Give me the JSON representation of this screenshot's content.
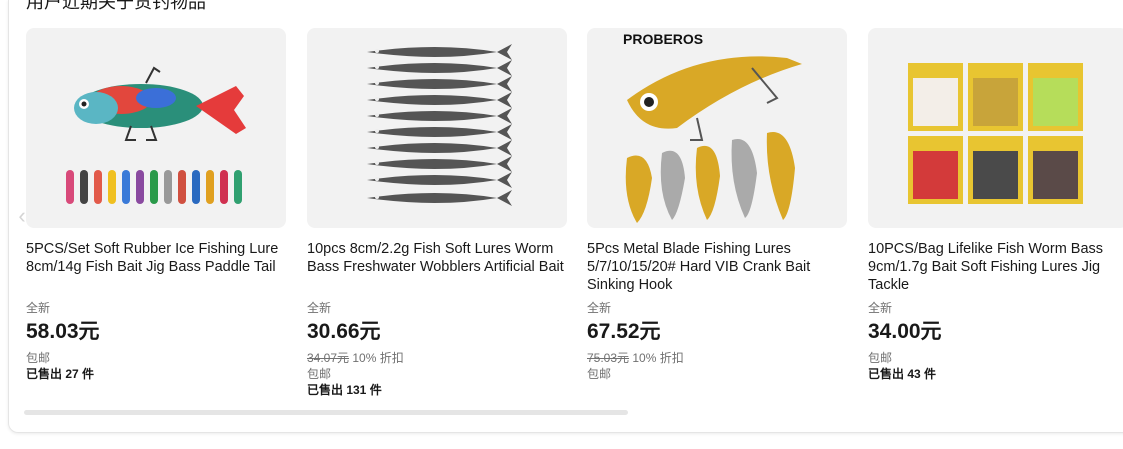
{
  "section": {
    "title": "用户近期关于货钓物品"
  },
  "products": [
    {
      "title": "5PCS/Set Soft Rubber Ice Fishing Lure 8cm/14g Fish Bait Jig Bass Paddle Tail",
      "condition": "全新",
      "price": "58.03元",
      "original_price": "",
      "discount": "",
      "shipping": "包邮",
      "sold": "已售出 27 件",
      "image_icon": "rubber-lure-set-image"
    },
    {
      "title": "10pcs 8cm/2.2g Fish Soft Lures Worm Bass Freshwater Wobblers Artificial Bait",
      "condition": "全新",
      "price": "30.66元",
      "original_price": "34.07元",
      "discount": "10% 折扣",
      "shipping": "包邮",
      "sold": "已售出 131 件",
      "image_icon": "soft-minnow-lures-image"
    },
    {
      "title": "5Pcs Metal Blade Fishing Lures 5/7/10/15/20# Hard VIB Crank Bait Sinking Hook",
      "condition": "全新",
      "price": "67.52元",
      "original_price": "75.03元",
      "discount": "10% 折扣",
      "shipping": "包邮",
      "sold": "",
      "image_icon": "metal-blade-lures-image",
      "image_brand": "PROBEROS"
    },
    {
      "title": "10PCS/Bag Lifelike Fish Worm Bass 9cm/1.7g Bait Soft Fishing Lures Jig Tackle",
      "condition": "全新",
      "price": "34.00元",
      "original_price": "",
      "discount": "",
      "shipping": "包邮",
      "sold": "已售出 43 件",
      "image_icon": "worm-lure-bags-image"
    }
  ],
  "carousel": {
    "prev_icon": "chevron-left-icon"
  }
}
